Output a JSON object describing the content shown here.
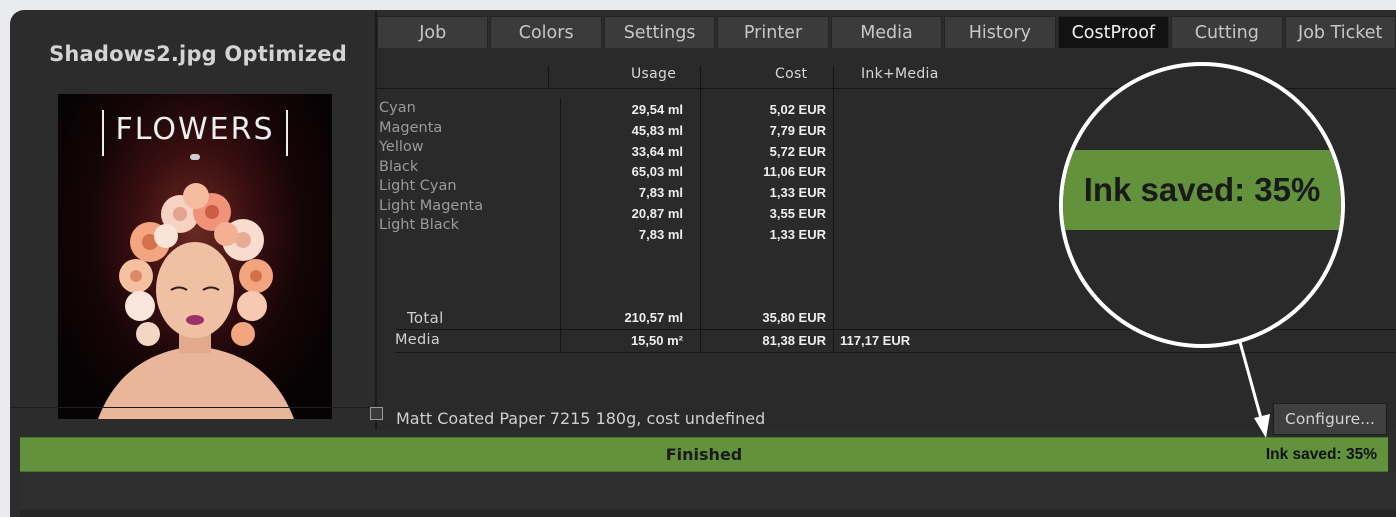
{
  "document": {
    "title": "Shadows2.jpg Optimized"
  },
  "preview": {
    "magazine_small": "FLOWERS",
    "magazine_title": "FLOWERS"
  },
  "tabs": [
    {
      "label": "Job"
    },
    {
      "label": "Colors"
    },
    {
      "label": "Settings"
    },
    {
      "label": "Printer"
    },
    {
      "label": "Media"
    },
    {
      "label": "History"
    },
    {
      "label": "CostProof",
      "active": true
    },
    {
      "label": "Cutting"
    },
    {
      "label": "Job Ticket"
    }
  ],
  "cost_table": {
    "headers": {
      "usage": "Usage",
      "cost": "Cost",
      "ink_media": "Ink+Media"
    },
    "rows": [
      {
        "name": "Cyan",
        "usage": "29,54 ml",
        "cost": "5,02 EUR"
      },
      {
        "name": "Magenta",
        "usage": "45,83 ml",
        "cost": "7,79 EUR"
      },
      {
        "name": "Yellow",
        "usage": "33,64 ml",
        "cost": "5,72 EUR"
      },
      {
        "name": "Black",
        "usage": "65,03 ml",
        "cost": "11,06 EUR"
      },
      {
        "name": "Light Cyan",
        "usage": "7,83 ml",
        "cost": "1,33 EUR"
      },
      {
        "name": "Light Magenta",
        "usage": "20,87 ml",
        "cost": "3,55 EUR"
      },
      {
        "name": "Light Black",
        "usage": "7,83 ml",
        "cost": "1,33 EUR"
      }
    ],
    "total": {
      "label": "Total",
      "usage": "210,57 ml",
      "cost": "35,80 EUR"
    },
    "media": {
      "label": "Media",
      "usage": "15,50 m²",
      "cost": "81,38 EUR",
      "ink_media": "117,17 EUR"
    }
  },
  "paper": {
    "description": "Matt Coated Paper 7215 180g, cost undefined"
  },
  "buttons": {
    "configure": "Configure..."
  },
  "status": {
    "text": "Finished",
    "ink_saved": "Ink saved: 35%"
  },
  "callout": {
    "text": "Ink saved: 35%"
  },
  "colors": {
    "status_green": "#62923b",
    "active_tab": "#121212",
    "panel": "#2a2a2a"
  }
}
